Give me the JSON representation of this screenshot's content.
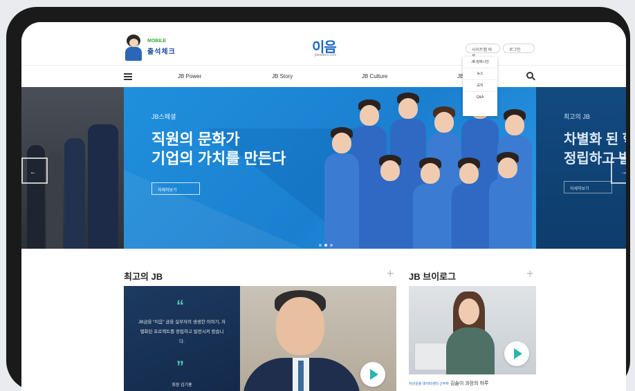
{
  "header": {
    "checkin_small": "MOBILE",
    "checkin_label": "출석체크",
    "logo": "이음",
    "logo_sub": "jbleaders.com",
    "sitemap_btn": "사이트맵 바로",
    "login_btn": "로그인"
  },
  "nav": {
    "items": [
      "JB Power",
      "JB Story",
      "JB Culture",
      "JB"
    ]
  },
  "dropdown": {
    "items": [
      "JB 컴퍼니언",
      "뉴스",
      "공지",
      "Q&A"
    ]
  },
  "hero": {
    "tag": "JB스페셜",
    "title_line1": "직원의 문화가",
    "title_line2": "기업의 가치를 만든다",
    "button": "자세히보기",
    "right_tag": "최고의 JB",
    "right_title_line1": "차별화 된 혁",
    "right_title_line2": "정립하고 발",
    "right_button": "자세히보기"
  },
  "sections": {
    "best_title": "최고의 JB",
    "vlog_title": "JB 브이로그",
    "plus": "+"
  },
  "quote": {
    "open": "“",
    "close": "”",
    "text": "JB금융 “이음” 금융 실무자의 생생한 이야기, 차별화된 프로젝트를 정립하고 발전시켜 왔습니다.",
    "name": "회장 김기홍"
  },
  "vlog": {
    "caption_prefix": "자산운용 데이터센터 근무자",
    "caption_main": "김솔이 과장의 하루"
  }
}
